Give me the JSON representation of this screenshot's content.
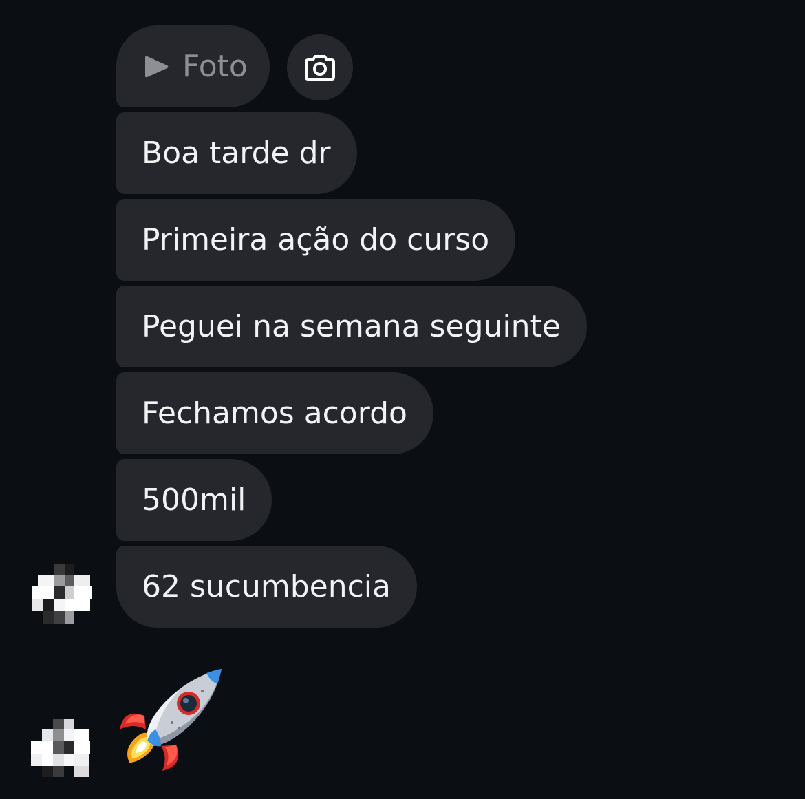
{
  "message_thread": {
    "photo_attachment": {
      "label": "Foto",
      "play_icon": "play-icon",
      "camera_icon": "camera-icon"
    },
    "messages": [
      {
        "text": "Boa tarde dr"
      },
      {
        "text": "Primeira ação do curso"
      },
      {
        "text": "Peguei na semana seguinte"
      },
      {
        "text": "Fechamos acordo"
      },
      {
        "text": "500mil"
      },
      {
        "text": "62 sucumbencia"
      }
    ],
    "emoji_reaction": {
      "icon": "rocket-icon"
    }
  },
  "colors": {
    "background": "#0b0e13",
    "bubble": "#25272c",
    "text": "#f2f2f4",
    "muted_text": "#8d8f95"
  }
}
